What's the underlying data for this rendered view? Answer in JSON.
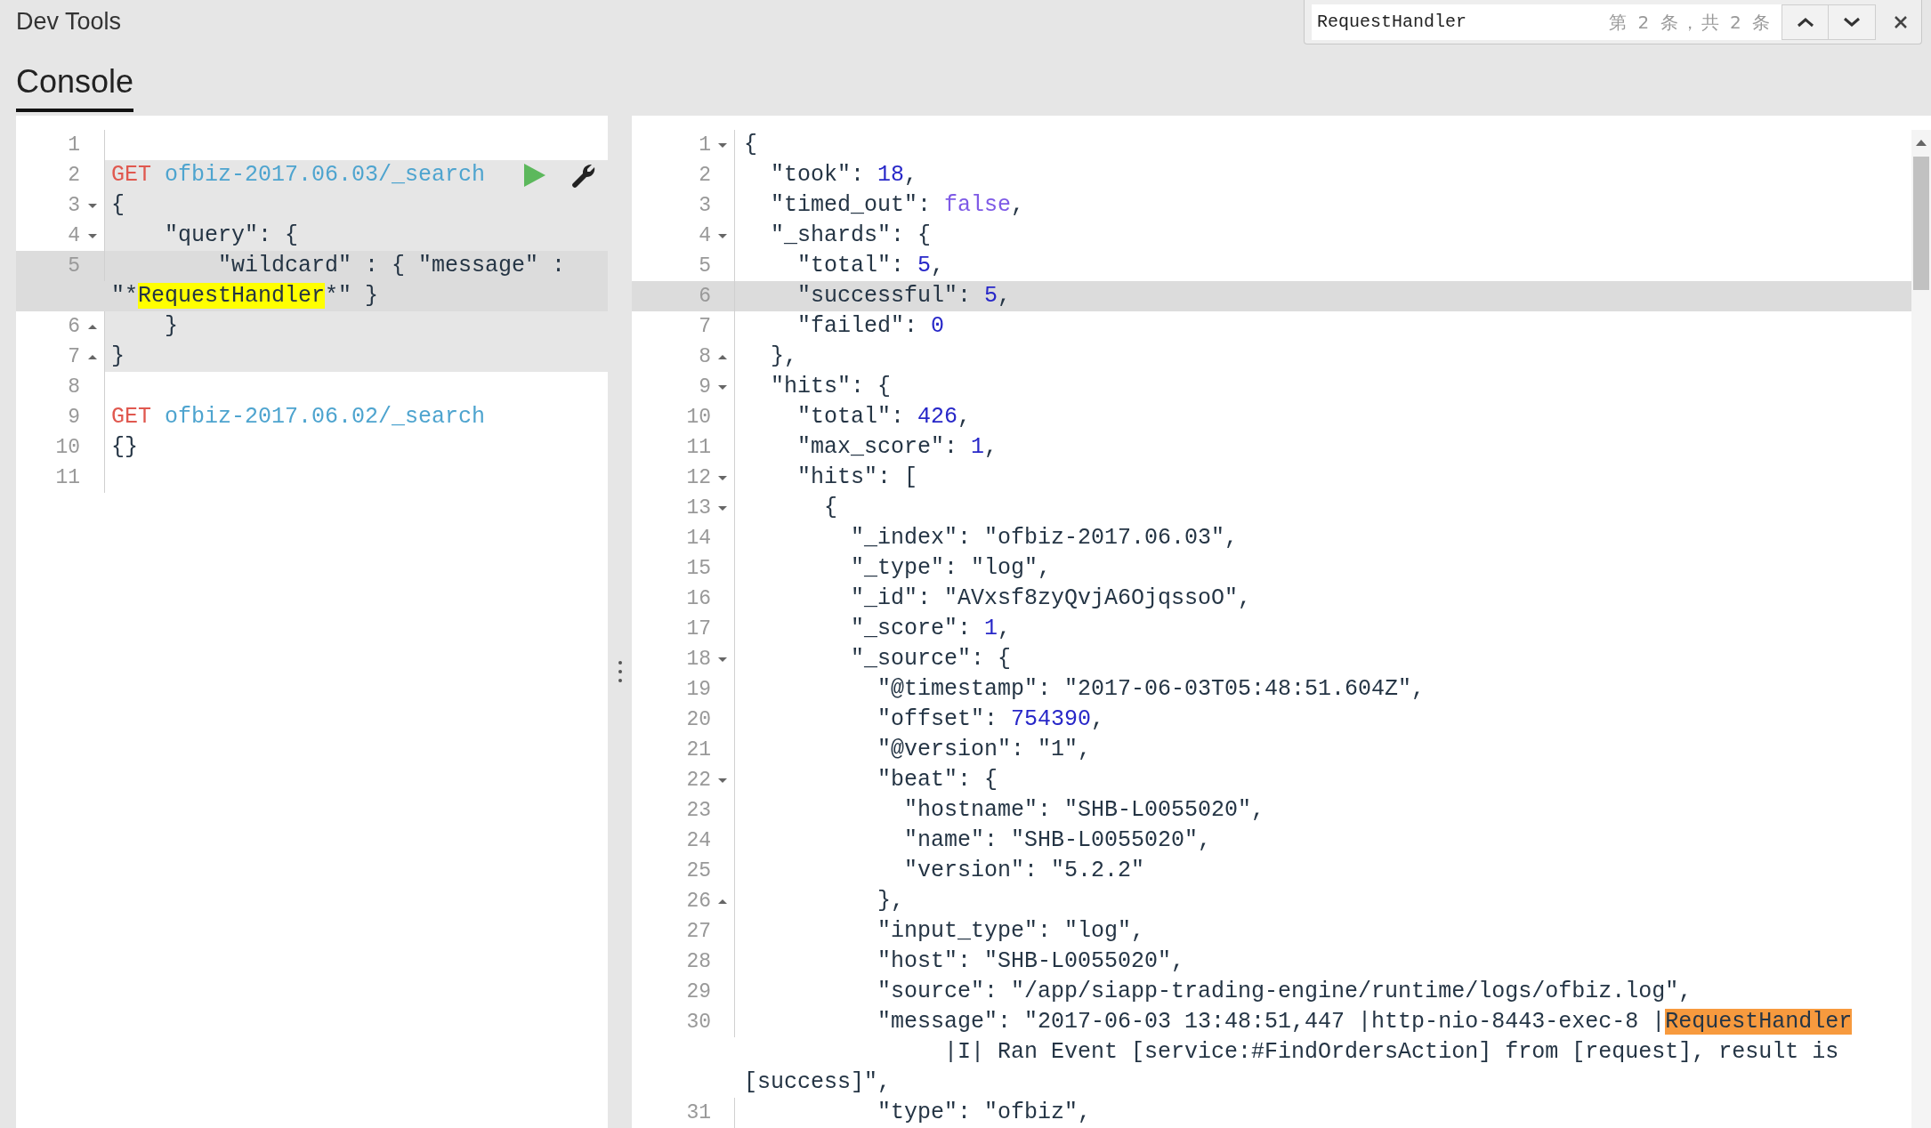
{
  "app_title": "Dev Tools",
  "find_bar": {
    "query": "RequestHandler",
    "count": "第 2 条，共 2 条"
  },
  "tabs": [
    {
      "label": "Console",
      "selected": true
    }
  ],
  "request_editor": {
    "lines": [
      {
        "number": "1",
        "kind": "plain",
        "highlighted": false,
        "active": false
      },
      {
        "number": "2",
        "kind": "plain",
        "highlighted": true,
        "active": false,
        "actions": true,
        "rows": [
          [
            {
              "text": "GET",
              "kind": "method"
            },
            {
              "text": " ofbiz-2017.06.03/_search",
              "kind": "url"
            }
          ]
        ]
      },
      {
        "number": "3",
        "kind": "fold-start",
        "highlighted": true,
        "active": false,
        "rows": [
          [
            {
              "text": "{",
              "kind": "text"
            }
          ]
        ]
      },
      {
        "number": "4",
        "kind": "fold-start",
        "highlighted": true,
        "active": false,
        "rows": [
          [
            {
              "text": "    \"query\": {",
              "kind": "text"
            }
          ]
        ]
      },
      {
        "number": "5",
        "kind": "plain",
        "highlighted": true,
        "active": true,
        "rows": [
          [
            {
              "text": "        \"wildcard\" : { \"message\" :",
              "kind": "text"
            }
          ]
        ],
        "continuations": [
          {
            "runs": [
              {
                "text": "\"*",
                "kind": "text"
              },
              {
                "text": "RequestHandler",
                "kind": "match"
              },
              {
                "text": "*\" }",
                "kind": "text"
              }
            ]
          }
        ]
      },
      {
        "number": "6",
        "kind": "fold-end",
        "highlighted": true,
        "active": false,
        "rows": [
          [
            {
              "text": "    }",
              "kind": "text"
            }
          ]
        ]
      },
      {
        "number": "7",
        "kind": "fold-end",
        "highlighted": true,
        "active": false,
        "rows": [
          [
            {
              "text": "}",
              "kind": "text"
            }
          ]
        ]
      },
      {
        "number": "8",
        "kind": "plain",
        "highlighted": false,
        "active": false
      },
      {
        "number": "9",
        "kind": "plain",
        "highlighted": false,
        "active": false,
        "rows": [
          [
            {
              "text": "GET",
              "kind": "method"
            },
            {
              "text": " ofbiz-2017.06.02/_search",
              "kind": "url"
            }
          ]
        ]
      },
      {
        "number": "10",
        "kind": "plain",
        "highlighted": false,
        "active": false,
        "rows": [
          [
            {
              "text": "{}",
              "kind": "text"
            }
          ]
        ]
      },
      {
        "number": "11",
        "kind": "plain",
        "highlighted": false,
        "active": false
      }
    ]
  },
  "response_viewer": {
    "lines": [
      {
        "number": "1",
        "kind": "fold-start",
        "active": false,
        "rows": [
          [
            {
              "text": "{",
              "kind": "text"
            }
          ]
        ]
      },
      {
        "number": "2",
        "kind": "plain",
        "active": false,
        "rows": [
          [
            {
              "text": "  \"took\": ",
              "kind": "text"
            },
            {
              "text": "18",
              "kind": "number"
            },
            {
              "text": ",",
              "kind": "text"
            }
          ]
        ]
      },
      {
        "number": "3",
        "kind": "plain",
        "active": false,
        "rows": [
          [
            {
              "text": "  \"timed_out\": ",
              "kind": "text"
            },
            {
              "text": "false",
              "kind": "bool"
            },
            {
              "text": ",",
              "kind": "text"
            }
          ]
        ]
      },
      {
        "number": "4",
        "kind": "fold-start",
        "active": false,
        "rows": [
          [
            {
              "text": "  \"_shards\": {",
              "kind": "text"
            }
          ]
        ]
      },
      {
        "number": "5",
        "kind": "plain",
        "active": false,
        "rows": [
          [
            {
              "text": "    \"total\": ",
              "kind": "text"
            },
            {
              "text": "5",
              "kind": "number"
            },
            {
              "text": ",",
              "kind": "text"
            }
          ]
        ]
      },
      {
        "number": "6",
        "kind": "plain",
        "active": true,
        "rows": [
          [
            {
              "text": "    \"successful\": ",
              "kind": "text"
            },
            {
              "text": "5",
              "kind": "number"
            },
            {
              "text": ",",
              "kind": "text"
            }
          ]
        ]
      },
      {
        "number": "7",
        "kind": "plain",
        "active": false,
        "rows": [
          [
            {
              "text": "    \"failed\": ",
              "kind": "text"
            },
            {
              "text": "0",
              "kind": "number"
            }
          ]
        ]
      },
      {
        "number": "8",
        "kind": "fold-end",
        "active": false,
        "rows": [
          [
            {
              "text": "  },",
              "kind": "text"
            }
          ]
        ]
      },
      {
        "number": "9",
        "kind": "fold-start",
        "active": false,
        "rows": [
          [
            {
              "text": "  \"hits\": {",
              "kind": "text"
            }
          ]
        ]
      },
      {
        "number": "10",
        "kind": "plain",
        "active": false,
        "rows": [
          [
            {
              "text": "    \"total\": ",
              "kind": "text"
            },
            {
              "text": "426",
              "kind": "number"
            },
            {
              "text": ",",
              "kind": "text"
            }
          ]
        ]
      },
      {
        "number": "11",
        "kind": "plain",
        "active": false,
        "rows": [
          [
            {
              "text": "    \"max_score\": ",
              "kind": "text"
            },
            {
              "text": "1",
              "kind": "number"
            },
            {
              "text": ",",
              "kind": "text"
            }
          ]
        ]
      },
      {
        "number": "12",
        "kind": "fold-start",
        "active": false,
        "rows": [
          [
            {
              "text": "    \"hits\": [",
              "kind": "text"
            }
          ]
        ]
      },
      {
        "number": "13",
        "kind": "fold-start",
        "active": false,
        "rows": [
          [
            {
              "text": "      {",
              "kind": "text"
            }
          ]
        ]
      },
      {
        "number": "14",
        "kind": "plain",
        "active": false,
        "rows": [
          [
            {
              "text": "        \"_index\": \"ofbiz-2017.06.03\",",
              "kind": "text"
            }
          ]
        ]
      },
      {
        "number": "15",
        "kind": "plain",
        "active": false,
        "rows": [
          [
            {
              "text": "        \"_type\": \"log\",",
              "kind": "text"
            }
          ]
        ]
      },
      {
        "number": "16",
        "kind": "plain",
        "active": false,
        "rows": [
          [
            {
              "text": "        \"_id\": \"AVxsf8zyQvjA6OjqssoO\",",
              "kind": "text"
            }
          ]
        ]
      },
      {
        "number": "17",
        "kind": "plain",
        "active": false,
        "rows": [
          [
            {
              "text": "        \"_score\": ",
              "kind": "text"
            },
            {
              "text": "1",
              "kind": "number"
            },
            {
              "text": ",",
              "kind": "text"
            }
          ]
        ]
      },
      {
        "number": "18",
        "kind": "fold-start",
        "active": false,
        "rows": [
          [
            {
              "text": "        \"_source\": {",
              "kind": "text"
            }
          ]
        ]
      },
      {
        "number": "19",
        "kind": "plain",
        "active": false,
        "rows": [
          [
            {
              "text": "          \"@timestamp\": \"2017-06-03T05:48:51.604Z\",",
              "kind": "text"
            }
          ]
        ]
      },
      {
        "number": "20",
        "kind": "plain",
        "active": false,
        "rows": [
          [
            {
              "text": "          \"offset\": ",
              "kind": "text"
            },
            {
              "text": "754390",
              "kind": "number"
            },
            {
              "text": ",",
              "kind": "text"
            }
          ]
        ]
      },
      {
        "number": "21",
        "kind": "plain",
        "active": false,
        "rows": [
          [
            {
              "text": "          \"@version\": \"1\",",
              "kind": "text"
            }
          ]
        ]
      },
      {
        "number": "22",
        "kind": "fold-start",
        "active": false,
        "rows": [
          [
            {
              "text": "          \"beat\": {",
              "kind": "text"
            }
          ]
        ]
      },
      {
        "number": "23",
        "kind": "plain",
        "active": false,
        "rows": [
          [
            {
              "text": "            \"hostname\": \"SHB-L0055020\",",
              "kind": "text"
            }
          ]
        ]
      },
      {
        "number": "24",
        "kind": "plain",
        "active": false,
        "rows": [
          [
            {
              "text": "            \"name\": \"SHB-L0055020\",",
              "kind": "text"
            }
          ]
        ]
      },
      {
        "number": "25",
        "kind": "plain",
        "active": false,
        "rows": [
          [
            {
              "text": "            \"version\": \"5.2.2\"",
              "kind": "text"
            }
          ]
        ]
      },
      {
        "number": "26",
        "kind": "fold-end",
        "active": false,
        "rows": [
          [
            {
              "text": "          },",
              "kind": "text"
            }
          ]
        ]
      },
      {
        "number": "27",
        "kind": "plain",
        "active": false,
        "rows": [
          [
            {
              "text": "          \"input_type\": \"log\",",
              "kind": "text"
            }
          ]
        ]
      },
      {
        "number": "28",
        "kind": "plain",
        "active": false,
        "rows": [
          [
            {
              "text": "          \"host\": \"SHB-L0055020\",",
              "kind": "text"
            }
          ]
        ]
      },
      {
        "number": "29",
        "kind": "plain",
        "active": false,
        "rows": [
          [
            {
              "text": "          \"source\": \"/app/siapp-trading-engine/runtime/logs/ofbiz.log\",",
              "kind": "text"
            }
          ]
        ]
      },
      {
        "number": "30",
        "kind": "plain",
        "active": false,
        "rows": [
          [
            {
              "text": "          \"message\": \"2017-06-03 13:48:51,447 |http-nio-8443-exec-8 |",
              "kind": "text"
            },
            {
              "text": "RequestHandler",
              "kind": "current-match"
            }
          ]
        ],
        "continuations": [
          {
            "runs": [
              {
                "text": "               |I| Ran Event [service:#FindOrdersAction] from [request], result is",
                "kind": "text"
              }
            ]
          },
          {
            "runs": [
              {
                "text": "[success]\",",
                "kind": "text"
              }
            ]
          }
        ]
      },
      {
        "number": "31",
        "kind": "plain",
        "active": false,
        "rows": [
          [
            {
              "text": "          \"type\": \"ofbiz\",",
              "kind": "text"
            }
          ]
        ]
      }
    ]
  }
}
